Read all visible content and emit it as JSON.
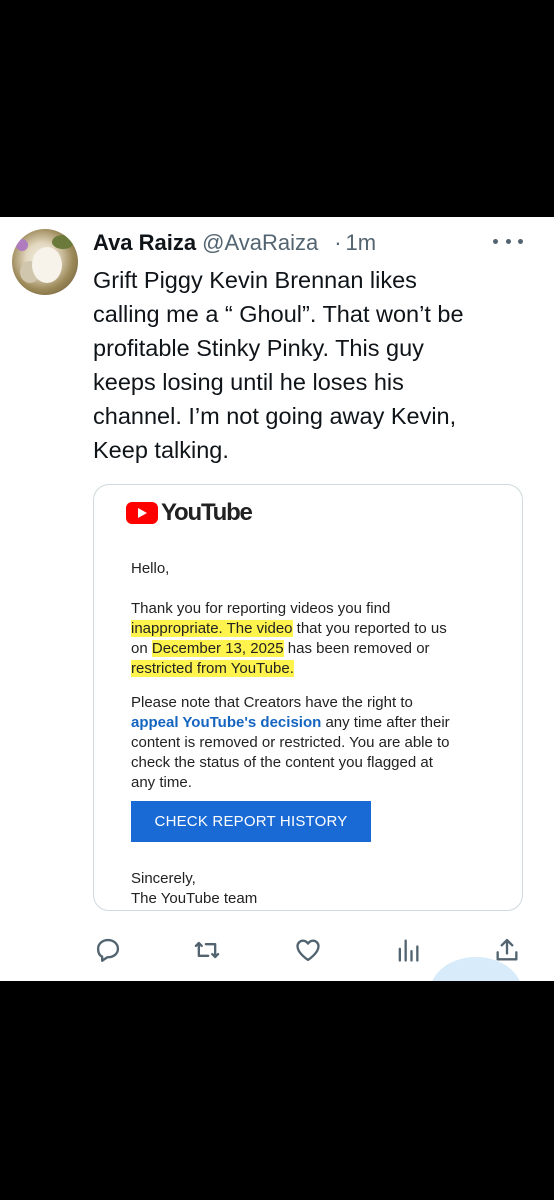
{
  "tweet": {
    "author_name": "Ava Raiza",
    "author_handle": "@AvaRaiza",
    "separator": "·",
    "time": "1m",
    "text_lines": [
      "Grift Piggy Kevin Brennan likes",
      "calling me a “ Ghoul”. That won’t be",
      "profitable Stinky Pinky. This guy",
      "keeps losing until he loses his",
      "channel. I’m not going away Kevin,",
      "Keep talking."
    ]
  },
  "email": {
    "brand": "YouTube",
    "greeting": "Hello,",
    "p1": {
      "l1": "Thank you for reporting videos you find",
      "l2a": "inappropriate. The video",
      "l2b": " that you reported to us",
      "l3a": "on ",
      "l3b": "December 13, 2025",
      "l3c": " has been removed or",
      "l4": "restricted from YouTube."
    },
    "p2": {
      "l1": "Please note that Creators have the right to",
      "link": "appeal YouTube's decision",
      "l2b": " any time after their",
      "l3": "content is removed or restricted. You are able to",
      "l4": "check the status of the content you flagged at",
      "l5": "any time."
    },
    "cta_label": "CHECK REPORT HISTORY",
    "signoff": "Sincerely,",
    "team": "The YouTube team"
  },
  "actions": [
    "reply-icon",
    "retweet-icon",
    "like-icon",
    "views-icon",
    "share-icon"
  ],
  "colors": {
    "text": "#0f1419",
    "muted": "#536471",
    "youtube_red": "#ff0000",
    "button_blue": "#1a6ad6",
    "link_blue": "#1565c0",
    "highlight": "#fff34d"
  }
}
